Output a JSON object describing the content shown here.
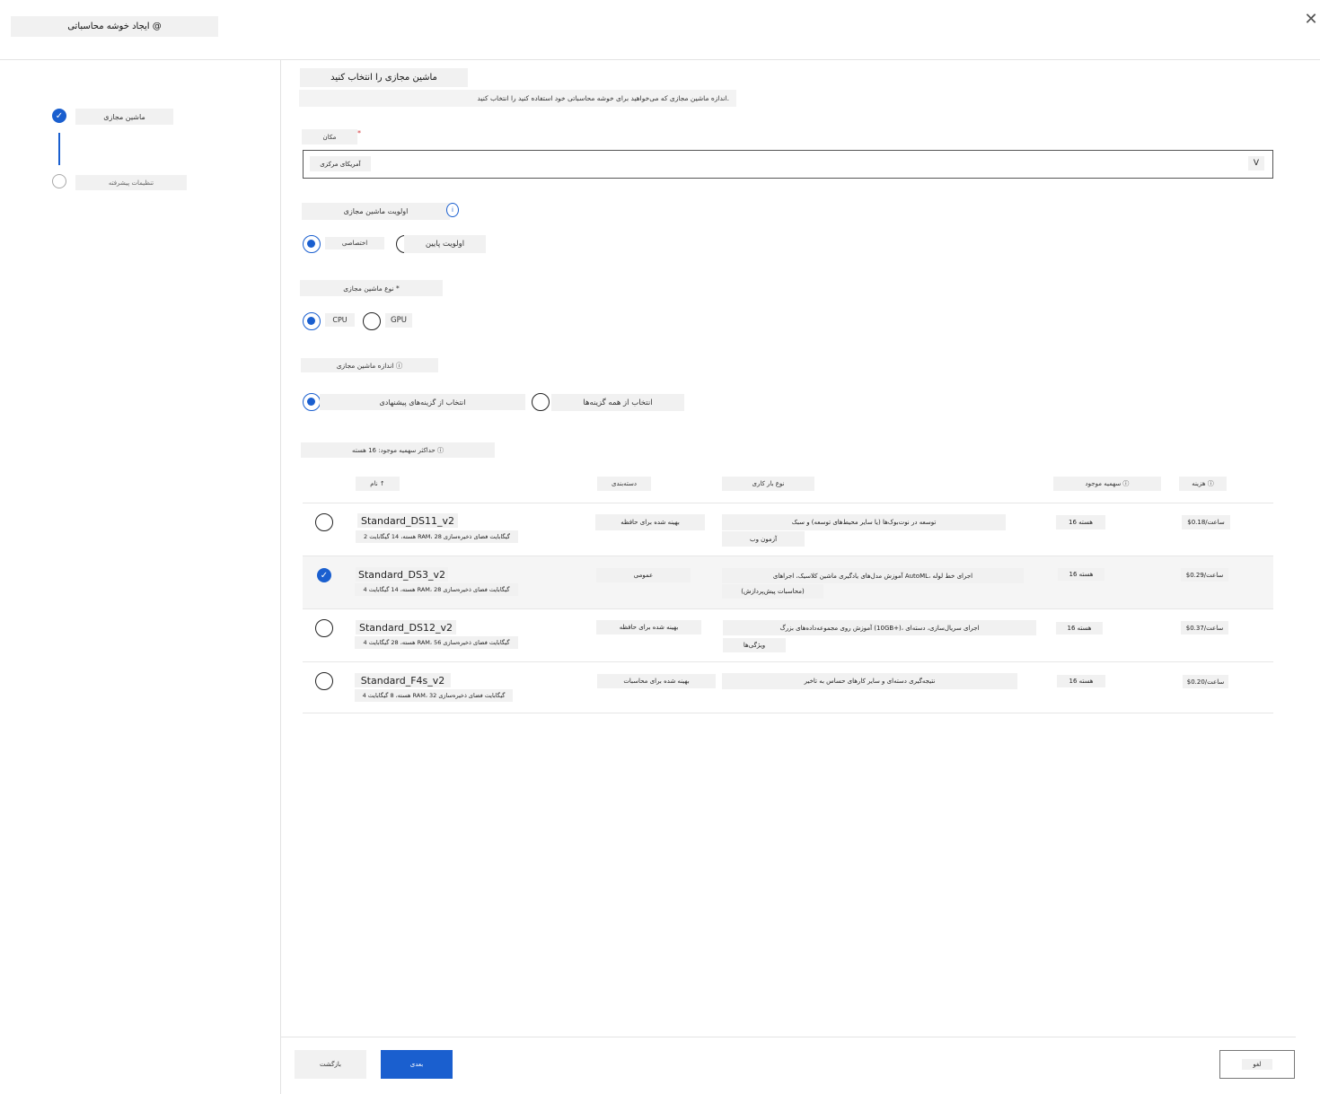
{
  "header": {
    "title": "ایجاد خوشه محاسباتی @",
    "close_glyph": "✕"
  },
  "stepper": {
    "steps": [
      {
        "label": "ماشین مجازی",
        "state": "done"
      },
      {
        "label": "تنظیمات پیشرفته",
        "state": "todo"
      }
    ]
  },
  "main": {
    "title": "ماشین مجازی را انتخاب کنید",
    "subtitle": "اندازه ماشین مجازی که می‌خواهید برای خوشه محاسباتی خود استفاده کنید را انتخاب کنید.",
    "location": {
      "label": "مکان",
      "required_mark": "*",
      "value": "آمریکای مرکزی",
      "chevron": "V"
    },
    "priority": {
      "label": "اولویت ماشین مجازی",
      "info_glyph": "i",
      "options": [
        {
          "label": "اختصاصی",
          "selected": true
        },
        {
          "label": "اولویت پایین",
          "selected": false
        }
      ]
    },
    "vm_type": {
      "label": "نوع ماشین مجازی *",
      "options": [
        {
          "label": "CPU",
          "selected": true
        },
        {
          "label": "GPU",
          "selected": false
        }
      ]
    },
    "vm_size": {
      "label": "اندازه ماشین مجازی ⓘ",
      "options": [
        {
          "label": "انتخاب از گزینه‌های پیشنهادی",
          "selected": true
        },
        {
          "label": "انتخاب از همه گزینه‌ها",
          "selected": false
        }
      ]
    },
    "quota_note": "حداکثر سهمیه موجود: 16 هسته ⓘ"
  },
  "table": {
    "headers": {
      "name": "نام ↑",
      "category": "دسته‌بندی",
      "workload": "نوع بار کاری",
      "quota": "سهمیه موجود ⓘ",
      "cost": "هزینه ⓘ"
    },
    "rows": [
      {
        "name": "Standard_DS11_v2",
        "spec": "2 هسته، 14 گیگابایت RAM، 28 گیگابایت فضای ذخیره‌سازی",
        "category": "بهینه شده برای حافظه",
        "workload": "توسعه در نوت‌بوک‌ها (یا سایر محیط‌های توسعه) و سبک",
        "workload2": "آزمون وب",
        "quota": "16 هسته",
        "cost": "$0.18/ساعت",
        "selected": false
      },
      {
        "name": "Standard_DS3_v2",
        "spec": "4 هسته، 14 گیگابایت RAM، 28 گیگابایت فضای ذخیره‌سازی",
        "category": "عمومی",
        "workload": "آموزش مدل‌های یادگیری ماشین کلاسیک، اجراهای AutoML، اجرای خط لوله",
        "workload2": "(محاسبات پیش‌پردازش)",
        "quota": "16 هسته",
        "cost": "$0.29/ساعت",
        "selected": true
      },
      {
        "name": "Standard_DS12_v2",
        "spec": "4 هسته، 28 گیگابایت RAM، 56 گیگابایت فضای ذخیره‌سازی",
        "category": "بهینه شده برای حافظه",
        "workload": "آموزش روی مجموعه‌داده‌های بزرگ (10GB+)، اجرای سریال‌سازی، دسته‌ای",
        "workload2": "ویژگی‌ها",
        "quota": "16 هسته",
        "cost": "$0.37/ساعت",
        "selected": false
      },
      {
        "name": "Standard_F4s_v2",
        "spec": "4 هسته، 8 گیگابایت RAM، 32 گیگابایت فضای ذخیره‌سازی",
        "category": "بهینه شده برای محاسبات",
        "workload": "نتیجه‌گیری دسته‌ای و سایر کارهای حساس به تاخیر",
        "workload2": "",
        "quota": "16 هسته",
        "cost": "$0.20/ساعت",
        "selected": false
      }
    ]
  },
  "footer": {
    "back_label": "بازگشت",
    "next_label": "بعدی",
    "cancel_label": "لغو"
  },
  "colors": {
    "accent": "#1a5fcf",
    "required": "#d13438"
  }
}
